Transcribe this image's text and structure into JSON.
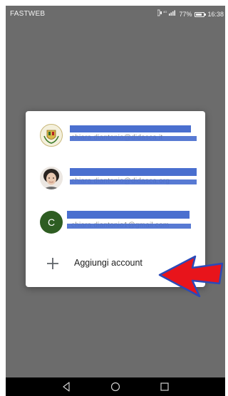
{
  "status_bar": {
    "carrier": "FASTWEB",
    "signal_text": "Ĳ‡⁺ᴷᴳ.∥",
    "battery_percent": "77%",
    "battery_level": 0.77,
    "time": "16:38"
  },
  "account_picker": {
    "accounts": [
      {
        "avatar": "crest-logo-icon",
        "name": "",
        "email": "chiara.diantonio@didasca.it"
      },
      {
        "avatar": "photo-icon",
        "name": "",
        "email": "chiara.diantonio@didasca.org"
      },
      {
        "avatar": "letter-avatar",
        "avatar_letter": "C",
        "name": "",
        "email": "chiara.diantonio1@gmail.com"
      }
    ],
    "add_account_label": "Aggiungi account",
    "add_account_icon": "plus-icon"
  },
  "annotation": {
    "arrow_icon": "red-arrow-icon",
    "arrow_color": "#e8141b"
  },
  "nav_bar": {
    "back_icon": "back-icon",
    "home_icon": "home-icon",
    "recents_icon": "recents-icon"
  },
  "colors": {
    "overlay": "#6c6c6c",
    "redaction": "#4a6fcf",
    "avatar_letter_bg": "#2e5d22",
    "dialog_bg": "#ffffff"
  }
}
